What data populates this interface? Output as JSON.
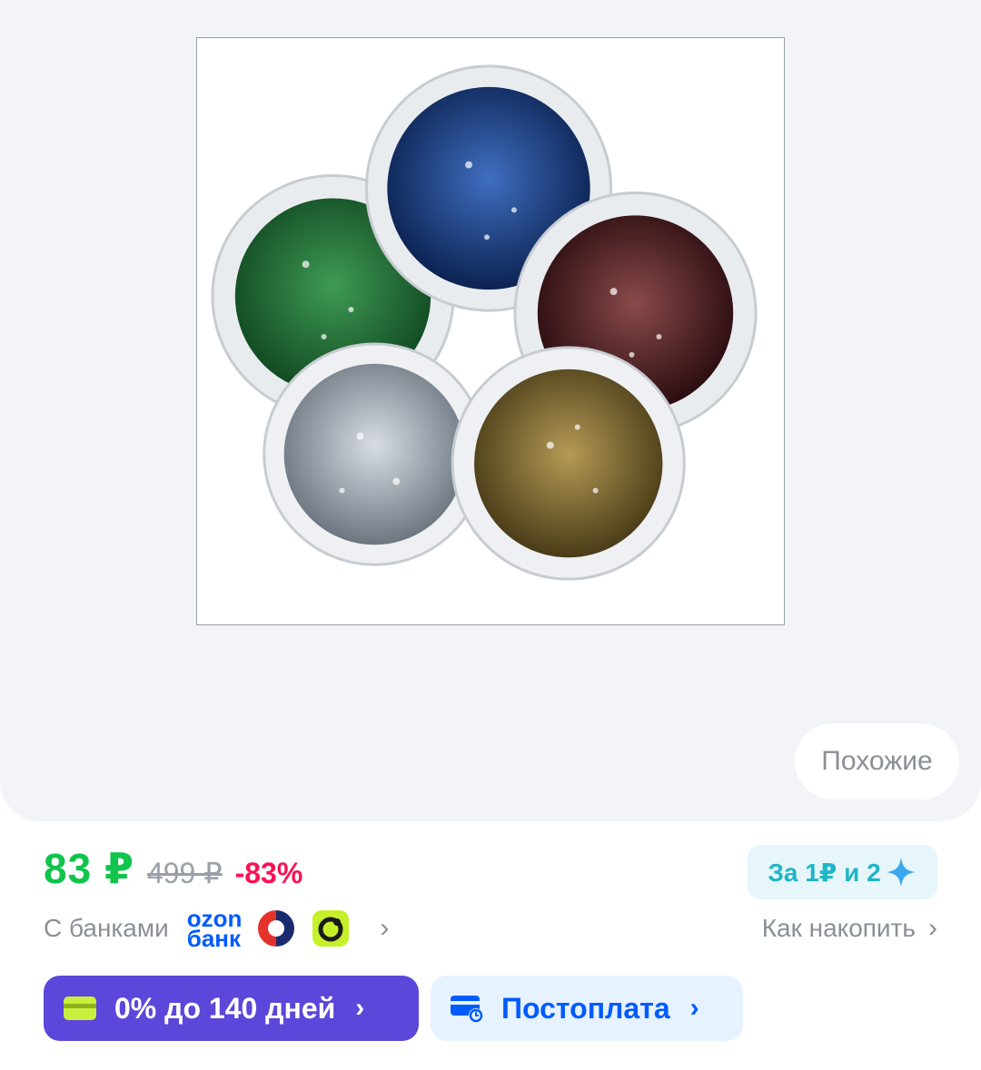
{
  "product": {
    "image_alt": "",
    "similar_label": "Похожие"
  },
  "price": {
    "current": "83 ₽",
    "old": "499 ₽",
    "discount": "-83%"
  },
  "banks": {
    "label": "С банками",
    "ozon_line1": "ozon",
    "ozon_line2": "банк",
    "icons": [
      "ozon-bank-logo",
      "sber-like-logo",
      "green-bank-logo"
    ]
  },
  "bonus": {
    "badge": "За 1₽ и 2",
    "how_to_save": "Как накопить"
  },
  "payments": {
    "installment": "0% до 140 дней",
    "postpay": "Постоплата"
  },
  "colors": {
    "price_green": "#10c44c",
    "discount_pink": "#f91155",
    "installment_purple": "#5b47d9",
    "ozon_blue": "#005bff"
  }
}
